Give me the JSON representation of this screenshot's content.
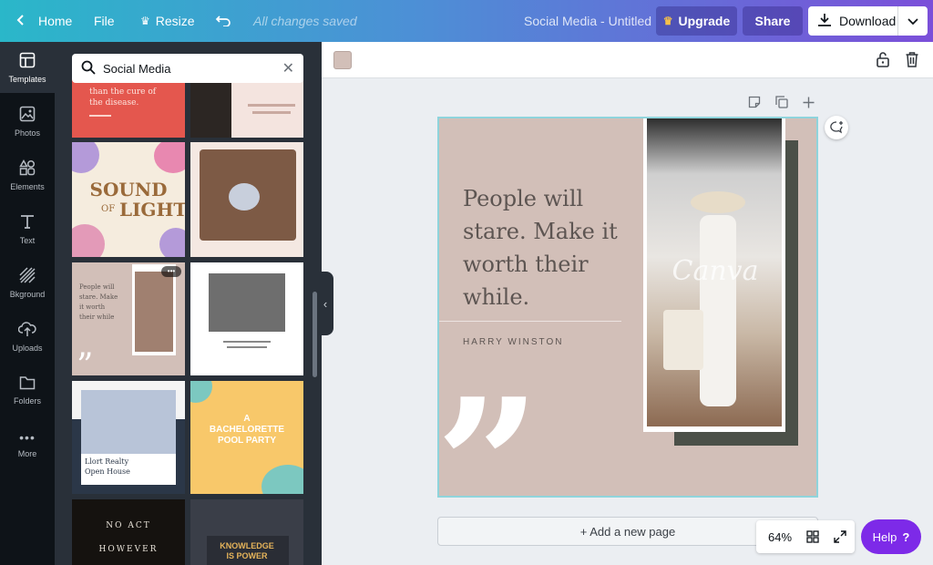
{
  "topbar": {
    "home_label": "Home",
    "file_label": "File",
    "resize_label": "Resize",
    "save_status": "All changes saved",
    "doc_title": "Social Media - Untitled",
    "upgrade_label": "Upgrade",
    "share_label": "Share",
    "download_label": "Download"
  },
  "rail": {
    "items": [
      {
        "label": "Templates",
        "icon": "templates-icon"
      },
      {
        "label": "Photos",
        "icon": "photos-icon"
      },
      {
        "label": "Elements",
        "icon": "elements-icon"
      },
      {
        "label": "Text",
        "icon": "text-icon"
      },
      {
        "label": "Bkground",
        "icon": "background-icon"
      },
      {
        "label": "Uploads",
        "icon": "uploads-icon"
      },
      {
        "label": "Folders",
        "icon": "folders-icon"
      },
      {
        "label": "More",
        "icon": "more-icon"
      }
    ]
  },
  "panel": {
    "search_value": "Social Media",
    "templates": {
      "t1_line1": "than the cure of",
      "t1_line2": "the disease.",
      "t3_title1": "SOUND",
      "t3_of": "OF",
      "t3_title2": "LIGHT",
      "t5_line1": "People will",
      "t5_line2": "stare. Make",
      "t5_line3": "it worth",
      "t5_line4": "their while",
      "t7_line1": "Llort Realty",
      "t7_line2": "Open House",
      "t8_line1": "A",
      "t8_line2": "BACHELORETTE",
      "t8_line3": "POOL PARTY",
      "t9_line1": "NO ACT",
      "t9_line2": "HOWEVER",
      "t10_line1": "KNOWLEDGE",
      "t10_line2": "IS POWER"
    }
  },
  "canvas": {
    "background": "#d2bfb8",
    "quote": "People will stare. Make it worth their while.",
    "author": "HARRY WINSTON",
    "watermark": "Canva",
    "add_page_label": "+ Add a new page"
  },
  "footer": {
    "zoom_level": "64%",
    "help_label": "Help",
    "help_symbol": "?"
  },
  "colors": {
    "help_button": "#7d2ae8",
    "selection_border": "#8fd4dc",
    "upgrade_crown": "#f5c04a"
  }
}
